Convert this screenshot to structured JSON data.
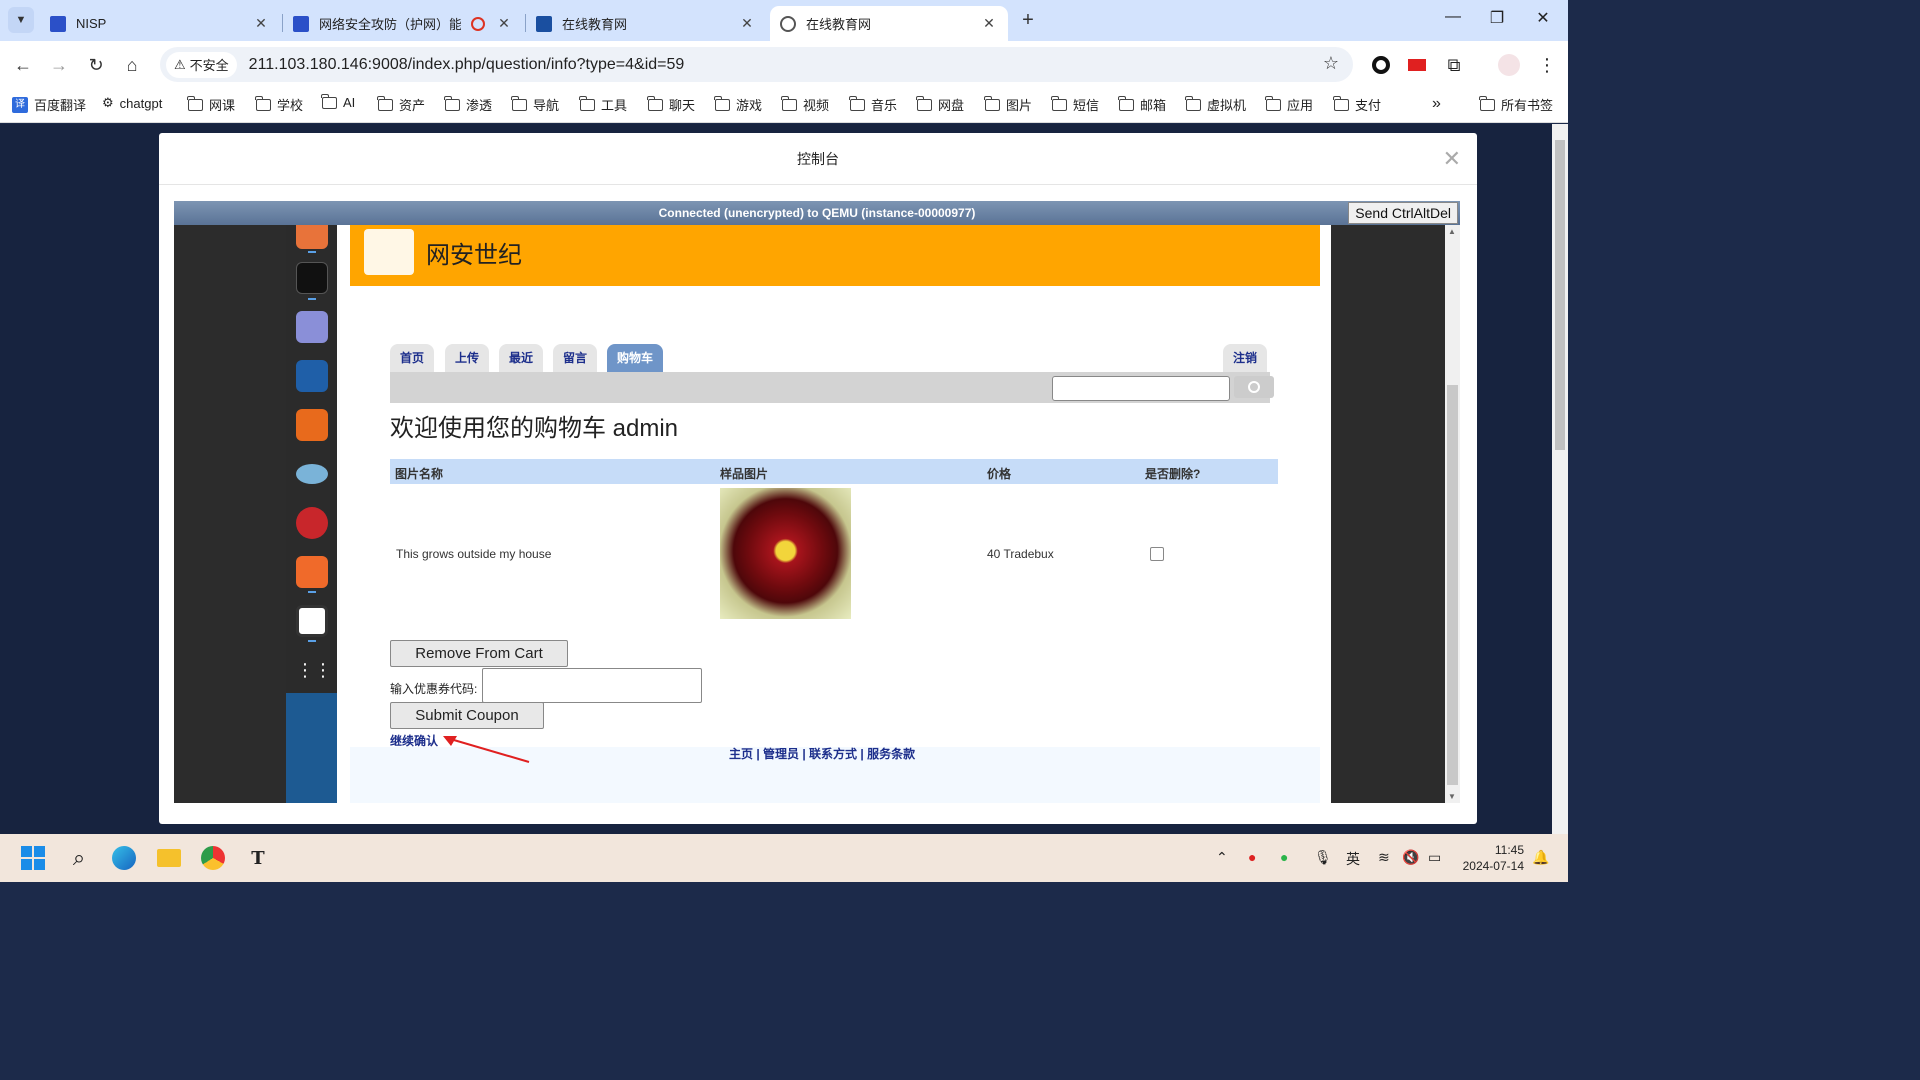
{
  "browser": {
    "tabs": [
      {
        "title": "NISP",
        "active": false
      },
      {
        "title": "网络安全攻防（护网）能力",
        "active": false
      },
      {
        "title": "在线教育网",
        "active": false
      },
      {
        "title": "在线教育网",
        "active": true
      }
    ],
    "address": {
      "security_label": "不安全",
      "url": "211.103.180.146:9008/index.php/question/info?type=4&id=59"
    },
    "bookmarks": [
      "百度翻译",
      "chatgpt",
      "网课",
      "学校",
      "AI",
      "资产",
      "渗透",
      "导航",
      "工具",
      "聊天",
      "游戏",
      "视频",
      "音乐",
      "网盘",
      "图片",
      "短信",
      "邮箱",
      "虚拟机",
      "应用",
      "支付"
    ],
    "bookmarks_more": "»",
    "all_bookmarks": "所有书签"
  },
  "modal": {
    "title": "控制台",
    "close": "✕"
  },
  "vnc": {
    "status": "Connected (unencrypted) to QEMU (instance-00000977)",
    "ctrl_alt_del": "Send CtrlAltDel"
  },
  "site": {
    "name": "网安世纪",
    "nav_tabs": [
      "首页",
      "上传",
      "最近",
      "留言",
      "购物车"
    ],
    "active_tab": "购物车",
    "logout": "注销",
    "welcome": "欢迎使用您的购物车 admin",
    "table": {
      "headers": [
        "图片名称",
        "样品图片",
        "价格",
        "是否删除?"
      ],
      "rows": [
        {
          "name": "This grows outside my house",
          "price": "40 Tradebux"
        }
      ]
    },
    "remove_button": "Remove From Cart",
    "coupon_label": "输入优惠券代码:",
    "submit_coupon": "Submit Coupon",
    "continue_link": "继续确认",
    "footer_links": "主页 | 管理员 | 联系方式 | 服务条款"
  },
  "taskbar": {
    "ime": "英",
    "time": "11:45",
    "date": "2024-07-14"
  }
}
